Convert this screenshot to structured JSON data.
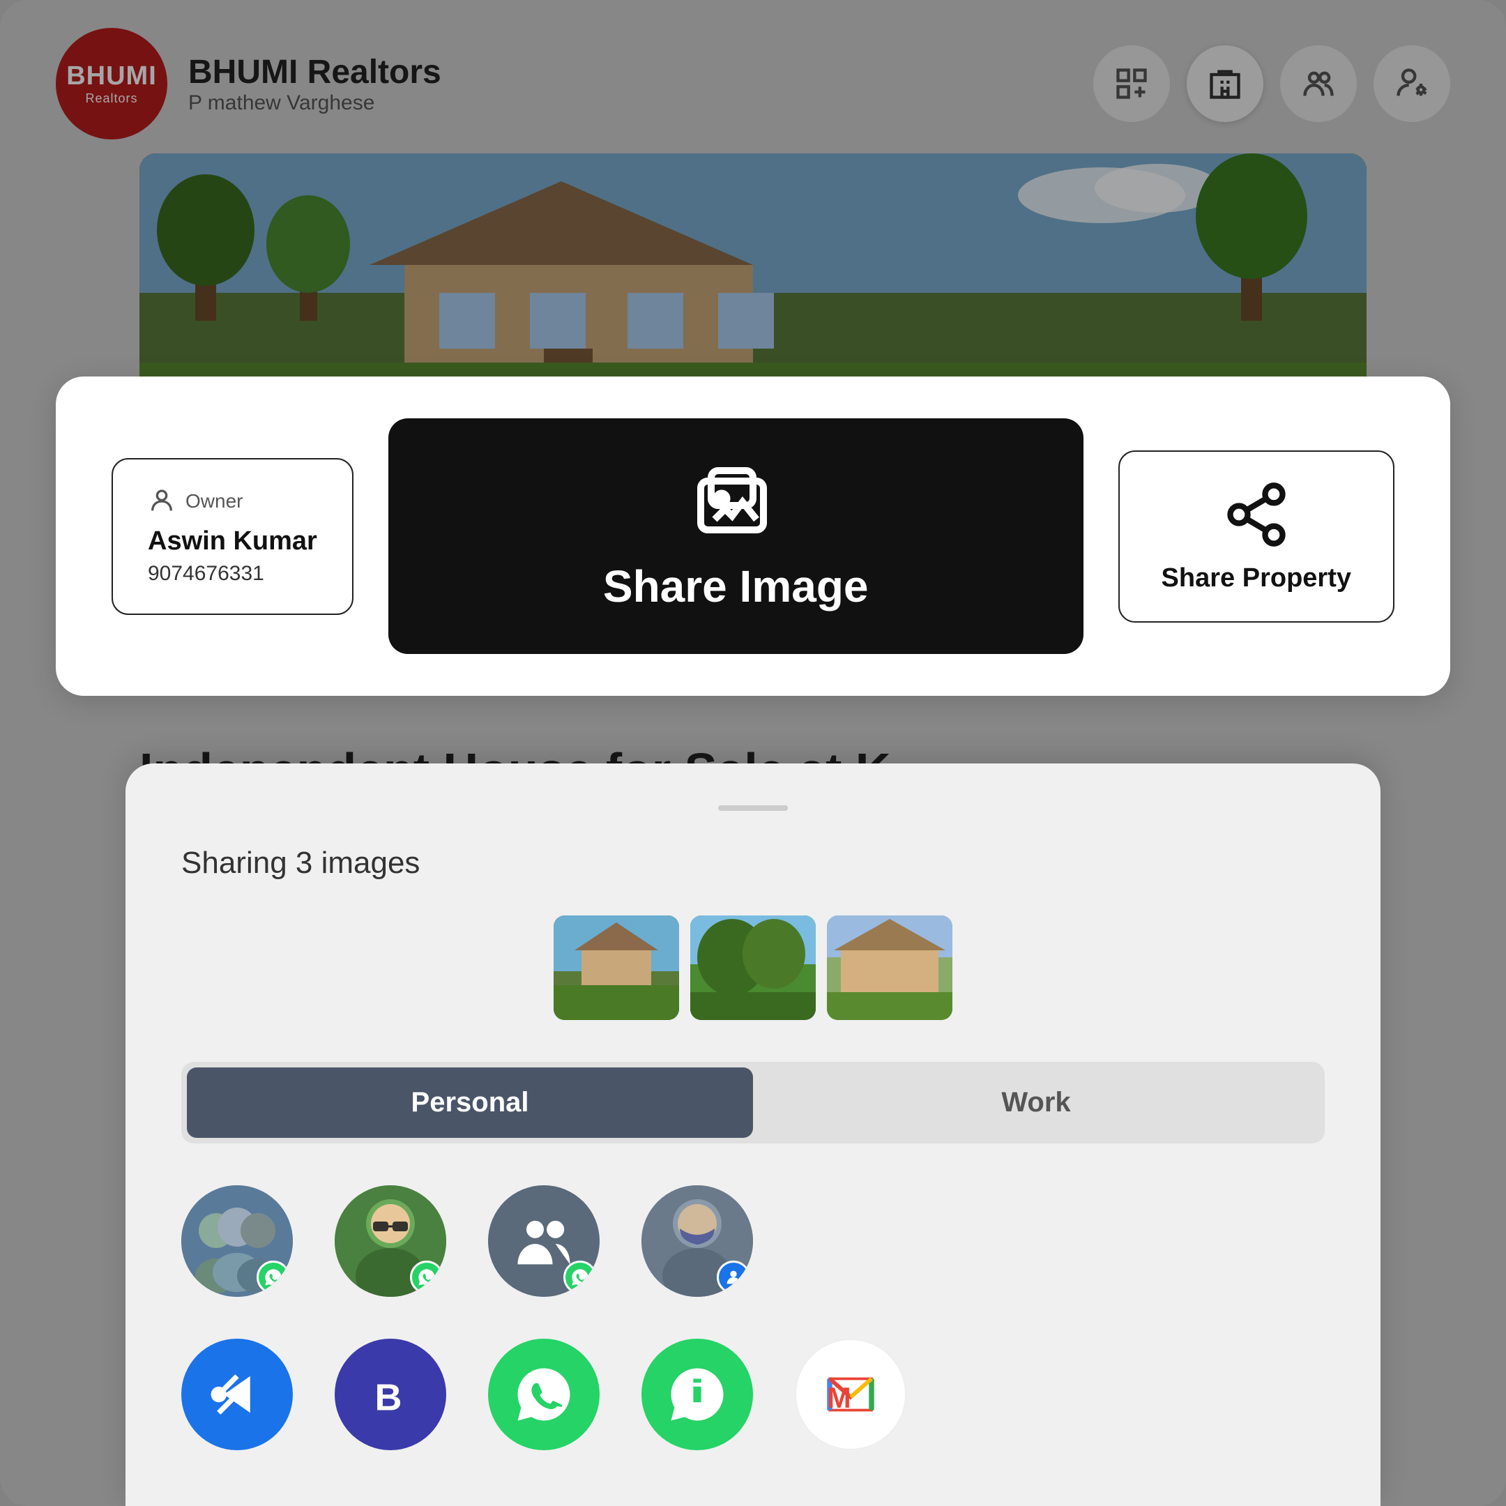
{
  "app": {
    "logo_main": "BHUMI",
    "logo_sub": "Realtors",
    "name": "BHUMI Realtors",
    "user": "P mathew Varghese"
  },
  "header": {
    "icons": [
      "grid-add-icon",
      "building-icon",
      "group-icon",
      "user-settings-icon"
    ]
  },
  "owner_card": {
    "label": "Owner",
    "name": "Aswin Kumar",
    "phone": "9074676331"
  },
  "share_image_btn": {
    "label": "Share Image"
  },
  "share_property_btn": {
    "label": "Share Property"
  },
  "property": {
    "title": "Independent House for Sale at K..."
  },
  "share_sheet": {
    "title": "Sharing 3 images",
    "handle": "",
    "tabs": [
      {
        "label": "Personal",
        "active": true
      },
      {
        "label": "Work",
        "active": false
      }
    ],
    "contacts": [
      {
        "id": 1,
        "badge": "whatsapp"
      },
      {
        "id": 2,
        "badge": "whatsapp"
      },
      {
        "id": 3,
        "badge": "contacts"
      },
      {
        "id": 4,
        "badge": "whatsapp-blue"
      }
    ],
    "apps": [
      {
        "id": "share",
        "label": "Share"
      },
      {
        "id": "beacon",
        "label": "Beacon"
      },
      {
        "id": "whatsapp",
        "label": "WhatsApp"
      },
      {
        "id": "whatsapp-biz",
        "label": "WhatsApp Business"
      },
      {
        "id": "gmail",
        "label": "Gmail"
      }
    ]
  }
}
